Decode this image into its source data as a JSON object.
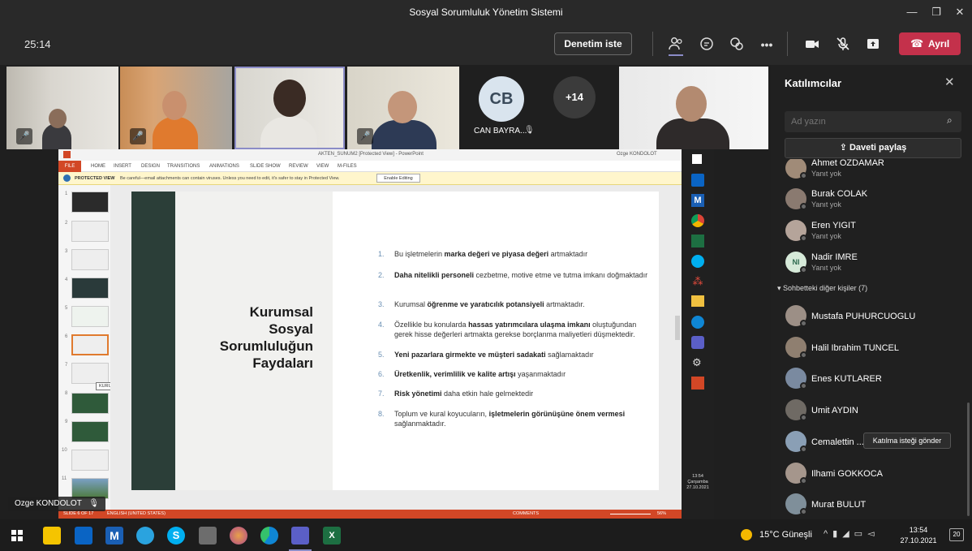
{
  "window": {
    "title": "Sosyal Sorumluluk Yönetim Sistemi"
  },
  "toolbar": {
    "timer": "25:14",
    "audit_btn": "Denetim iste",
    "leave_btn": "Ayrıl"
  },
  "video": {
    "cb_initials": "CB",
    "cb_name": "CAN BAYRA...",
    "more_count": "+14",
    "presenter_name": "Ozge KONDOLOT"
  },
  "ppt": {
    "title_bar": "AKTEN_SUNUM2 [Protected View] - PowerPoint",
    "user": "Ozge KONDOLOT",
    "ribbon": [
      "FILE",
      "HOME",
      "INSERT",
      "DESIGN",
      "TRANSITIONS",
      "ANIMATIONS",
      "SLIDE SHOW",
      "REVIEW",
      "VIEW",
      "M-FILES"
    ],
    "protected_label": "PROTECTED VIEW",
    "protected_text": "Be careful—email attachments can contain viruses. Unless you need to edit, it's safer to stay in Protected View.",
    "enable_btn": "Enable Editing",
    "thumb_tooltip": "KURUMSAL RISKLER",
    "slide_title": [
      "Kurumsal",
      "Sosyal",
      "Sorumluluğun",
      "Faydaları"
    ],
    "status_left": "SLIDE 6 OF 17",
    "status_lang": "ENGLISH (UNITED STATES)",
    "status_comments": "COMMENTS",
    "zoom": "56%",
    "slide_nums": [
      "1",
      "2",
      "3",
      "4",
      "5",
      "6",
      "7",
      "8",
      "9",
      "10",
      "11"
    ],
    "bullets": [
      {
        "n": "1.",
        "a": "Bu işletmelerin ",
        "b": "marka değeri ve piyasa değeri",
        "c": " artmaktadır"
      },
      {
        "n": "2.",
        "a": "",
        "b": "Daha nitelikli personeli",
        "c": " cezbetme, motive etme ve tutma imkanı doğmaktadır"
      },
      {
        "n": "3.",
        "a": "Kurumsal ",
        "b": "öğrenme ve yaratıcılık potansiyeli",
        "c": " artmaktadır."
      },
      {
        "n": "4.",
        "a": "Özellikle bu konularda ",
        "b": "hassas yatırımcılara ulaşma imkanı",
        "c": " oluştuğundan gerek hisse değerleri artmakta gerekse borçlanma maliyetleri düşmektedir."
      },
      {
        "n": "5.",
        "a": "",
        "b": "Yeni pazarlara girmekte ve müşteri sadakati",
        "c": " sağlamaktadır"
      },
      {
        "n": "6.",
        "a": "",
        "b": "Üretkenlik, verimlilik ve kalite artışı",
        "c": " yaşanmaktadır"
      },
      {
        "n": "7.",
        "a": "",
        "b": "Risk yönetimi",
        "c": " daha etkin hale gelmektedir"
      },
      {
        "n": "8.",
        "a": "Toplum ve kural koyucuların, ",
        "b": "işletmelerin görünüşüne önem vermesi",
        "c": " sağlanmaktadır."
      }
    ]
  },
  "side_clock": {
    "time": "13:54",
    "day": "Çarşamba",
    "date": "27.10.2021"
  },
  "panel": {
    "title": "Katılımcılar",
    "search_placeholder": "Ad yazın",
    "share_btn": "Daveti paylaş",
    "no_reply": "Yanıt yok",
    "top": [
      {
        "name": "Ahmet OZDAMAR"
      },
      {
        "name": "Burak COLAK"
      },
      {
        "name": "Eren YIGIT"
      },
      {
        "name": "Nadir IMRE",
        "initials": "NI"
      }
    ],
    "other_header": "Sohbetteki diğer kişiler (7)",
    "others": [
      "Mustafa PUHURCUOGLU",
      "Halil Ibrahim TUNCEL",
      "Enes KUTLARER",
      "Umit AYDIN",
      "Cemalettin ...",
      "Ilhami GOKKOCA",
      "Murat BULUT"
    ],
    "request_btn": "Katılma isteği gönder"
  },
  "taskbar": {
    "weather": "15°C  Güneşli",
    "time": "13:54",
    "date": "27.10.2021",
    "notif": "20"
  }
}
